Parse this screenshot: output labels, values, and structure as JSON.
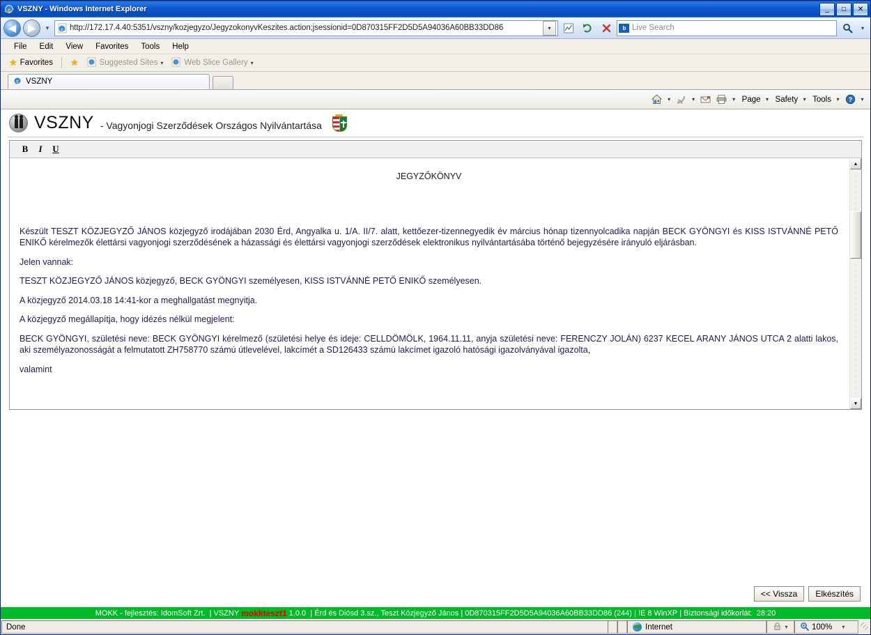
{
  "window": {
    "title": "VSZNY - Windows Internet Explorer",
    "minimize_label": "_",
    "maximize_label": "□",
    "close_label": "✕"
  },
  "nav": {
    "back_label": "◀",
    "forward_label": "▶",
    "history_dropdown_label": "▾",
    "url": "http://172.17.4.40:5351/vszny/kozjegyzo/JegyzokonyvKeszites.action;jsessionid=0D870315FF2D5D5A94036A60BB33DD86",
    "address_dropdown_label": "▾",
    "compat_view_label": "▤",
    "refresh_label": "↻",
    "stop_label": "✕",
    "search_logo_text": "b",
    "search_placeholder": "Live Search",
    "search_go_label": "⚲",
    "search_dropdown_label": "▾"
  },
  "menu": {
    "items": [
      "File",
      "Edit",
      "View",
      "Favorites",
      "Tools",
      "Help"
    ]
  },
  "favorites_bar": {
    "favorites_label": "Favorites",
    "add_label": "",
    "suggested_sites_label": "Suggested Sites",
    "web_slice_label": "Web Slice Gallery",
    "dropdown_label": "▾"
  },
  "tabs": {
    "active_tab_label": "VSZNY",
    "new_tab_label": ""
  },
  "command_bar": {
    "home_label": "⌂",
    "feeds_label": "◰",
    "mail_label": "✉",
    "print_label": "⎙",
    "page_label": "Page",
    "safety_label": "Safety",
    "tools_label": "Tools",
    "help_label": "?",
    "dropdown_label": "▾"
  },
  "app_header": {
    "brand": "VSZNY",
    "subtitle": "- Vagyonjogi Szerződések Országos Nyilvántartása"
  },
  "editor": {
    "toolbar": {
      "bold_label": "B",
      "italic_label": "I",
      "underline_label": "U"
    },
    "scroll": {
      "up_label": "▲",
      "down_label": "▼"
    },
    "document": {
      "title": "JEGYZŐKÖNYV",
      "paragraphs": [
        "Készült TESZT KÖZJEGYZŐ JÁNOS közjegyző irodájában 2030 Érd, Angyalka u. 1/A. II/7. alatt, kettőezer-tizennegyedik év március hónap tizennyolcadika napján BECK GYÖNGYI és KISS ISTVÁNNÉ PETŐ ENIKŐ kérelmezők élettársi vagyonjogi szerződésének a házassági és élettársi vagyonjogi szerződések elektronikus nyilvántartásába történő bejegyzésére irányuló eljárásban.",
        "Jelen vannak:",
        "TESZT KÖZJEGYZŐ JÁNOS közjegyző, BECK GYÖNGYI személyesen, KISS ISTVÁNNÉ PETŐ ENIKŐ személyesen.",
        "A közjegyző 2014.03.18 14:41-kor a meghallgatást megnyitja.",
        "A közjegyző megállapítja, hogy idézés nélkül megjelent:",
        "BECK GYÖNGYI, születési neve: BECK GYÖNGYI kérelmező (születési helye és ideje: CELLDÖMÖLK, 1964.11.11, anyja születési neve: FERENCZY JOLÁN) 6237 KECEL ARANY JÁNOS UTCA 2 alatti lakos, aki személyazonosságát a felmutatott ZH758770 számú útlevelével, lakcímét a SD126433 számú lakcímet igazoló hatósági igazolványával igazolta,",
        "valamint"
      ]
    }
  },
  "form_buttons": {
    "back_label": "<< Vissza",
    "submit_label": "Elkészítés"
  },
  "app_status_bar": {
    "developer": "MOKK - fejlesztés: IdomSoft Zrt.",
    "sep1": "|",
    "system": "VSZNY",
    "environment": "mokkteszt1",
    "version": "1.0.0",
    "sep2": "|",
    "office": "Érd és Diósd 3.sz., Teszt Közjegyző János",
    "sep3": "|",
    "session": "0D870315FF2D5D5A94036A60BB33DD86 (244)",
    "sep4": "|",
    "browser": "IE 8 WinXP",
    "sep5": "|",
    "timeout_label": "Biztonsági időkorlát:",
    "timeout_value": "28:20"
  },
  "ie_status_bar": {
    "status": "Done",
    "zone": "Internet",
    "lock_label": "🔒",
    "zoom": "100%",
    "dropdown_label": "▾"
  },
  "colors": {
    "green_bar": "#00b828",
    "red_text": "#e60000",
    "doc_text": "#27184d",
    "title_bar": "#0c5ad4"
  }
}
